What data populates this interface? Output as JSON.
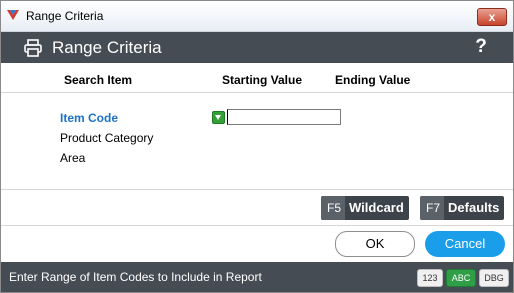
{
  "window": {
    "title": "Range Criteria",
    "close_label": "x"
  },
  "header": {
    "title": "Range Criteria",
    "help_label": "?"
  },
  "columns": {
    "search_item": "Search Item",
    "starting_value": "Starting Value",
    "ending_value": "Ending Value"
  },
  "items": [
    {
      "label": "Item Code",
      "active": true
    },
    {
      "label": "Product Category",
      "active": false
    },
    {
      "label": "Area",
      "active": false
    }
  ],
  "fields": {
    "starting_value": ""
  },
  "buttons": {
    "wildcard": {
      "key": "F5",
      "label": "Wildcard"
    },
    "defaults": {
      "key": "F7",
      "label": "Defaults"
    },
    "ok": "OK",
    "cancel": "Cancel"
  },
  "status": {
    "message": "Enter Range of Item Codes to Include in Report",
    "indicators": [
      "123",
      "ABC",
      "DBG"
    ]
  },
  "colors": {
    "header_bg": "#454c54",
    "accent": "#1a9eea",
    "active_item": "#1c73c5",
    "abc_indicator": "#2f9e46"
  }
}
